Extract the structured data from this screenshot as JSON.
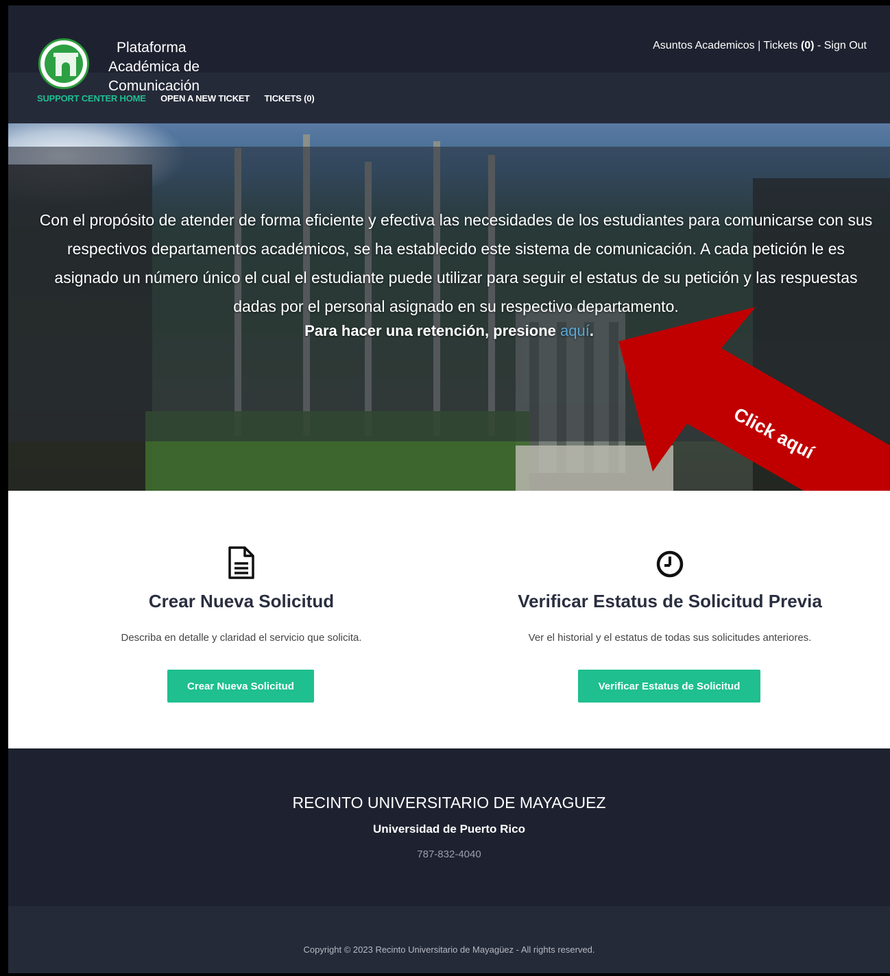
{
  "header": {
    "brand_line1": "Plataforma",
    "brand_line2": "Académica de",
    "brand_line3": "Comunicación",
    "user_name": "Asuntos Academicos",
    "separator": " | ",
    "tickets_label": "Tickets ",
    "tickets_count": "(0)",
    "signout_prefix": " - ",
    "signout_label": "Sign Out"
  },
  "nav": {
    "items": [
      {
        "label": "SUPPORT CENTER HOME",
        "active": true
      },
      {
        "label": "OPEN A NEW TICKET",
        "active": false
      },
      {
        "label": "TICKETS (0)",
        "active": false
      }
    ]
  },
  "hero": {
    "intro": "Con el propósito de atender de forma eficiente y efectiva las necesidades de los estudiantes para comunicarse con sus respectivos departamentos académicos, se ha establecido este sistema de comunicación. A cada petición le es asignado un número único el cual el estudiante puede utilizar para seguir el estatus de su petición y las respuestas dadas por el personal asignado en su respectivo departamento.",
    "cta_text": "Para hacer una retención, presione ",
    "cta_link": "aquí",
    "cta_end": "."
  },
  "annotation": {
    "label": "Click aquí",
    "color": "#c00000"
  },
  "cards": {
    "new": {
      "title": "Crear Nueva Solicitud",
      "description": "Describa en detalle y claridad el servicio que solicita.",
      "button": "Crear Nueva Solicitud"
    },
    "status": {
      "title": "Verificar Estatus de Solicitud Previa",
      "description": "Ver el historial y el estatus de todas sus solicitudes anteriores.",
      "button": "Verificar Estatus de Solicitud"
    }
  },
  "footer": {
    "campus": "RECINTO UNIVERSITARIO DE MAYAGUEZ",
    "university": "Universidad de Puerto Rico",
    "phone": "787-832-4040",
    "copyright": "Copyright © 2023 Recinto Universitario de Mayagüez - All rights reserved."
  },
  "colors": {
    "accent": "#1fbf8f",
    "header_bg": "#1e2230",
    "link": "#5aa8d8"
  }
}
